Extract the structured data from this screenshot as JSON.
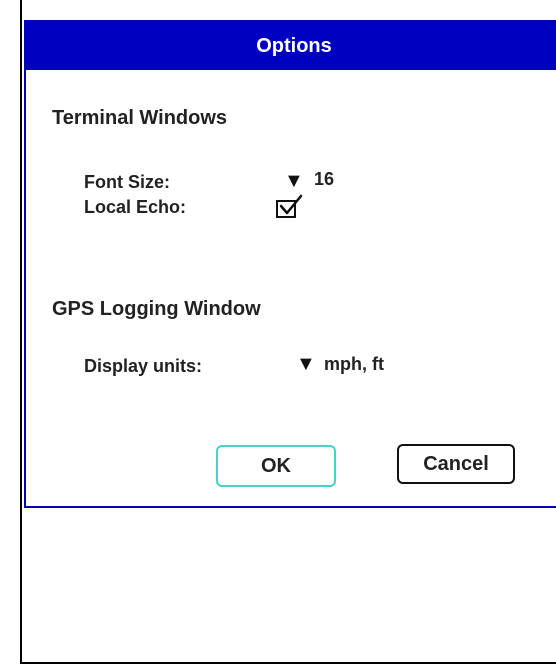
{
  "dialog": {
    "title": "Options"
  },
  "terminal": {
    "heading": "Terminal Windows",
    "font_size_label": "Font Size:",
    "font_size_value": "16",
    "local_echo_label": "Local Echo:",
    "local_echo_checked": true
  },
  "gps": {
    "heading": "GPS Logging Window",
    "units_label": "Display units:",
    "units_value": "mph, ft"
  },
  "buttons": {
    "ok": "OK",
    "cancel": "Cancel"
  },
  "colors": {
    "titlebar": "#0000c0",
    "ok_focus_border": "#47d4c4"
  }
}
